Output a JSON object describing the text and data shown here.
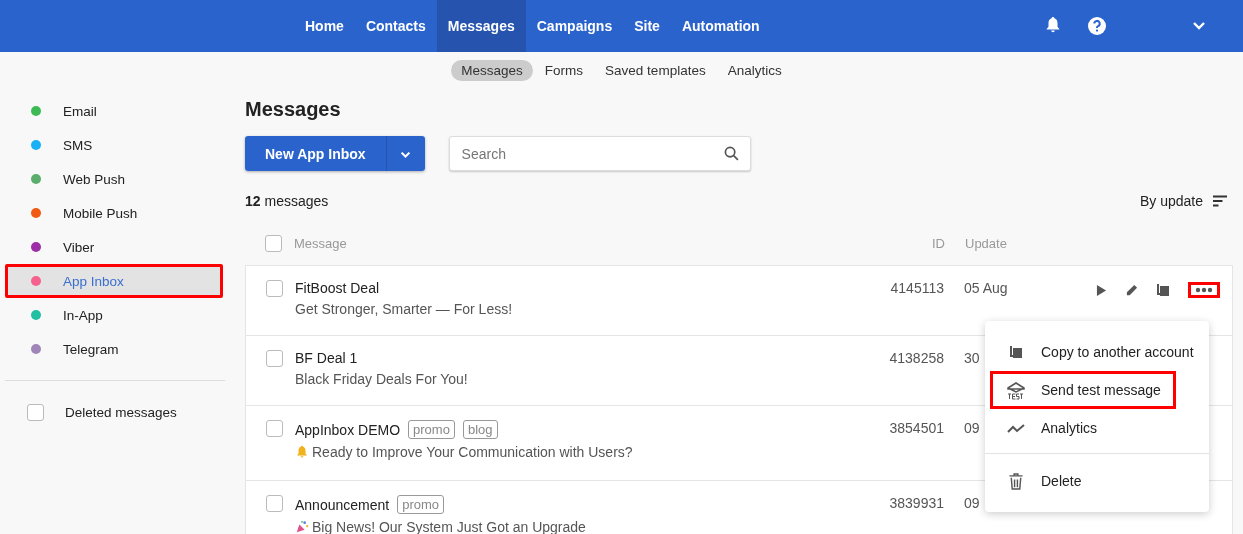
{
  "top_nav": {
    "items": [
      {
        "label": "Home",
        "selected": false
      },
      {
        "label": "Contacts",
        "selected": false
      },
      {
        "label": "Messages",
        "selected": true
      },
      {
        "label": "Campaigns",
        "selected": false
      },
      {
        "label": "Site",
        "selected": false
      },
      {
        "label": "Automation",
        "selected": false
      }
    ]
  },
  "sub_nav": {
    "items": [
      {
        "label": "Messages",
        "selected": true
      },
      {
        "label": "Forms",
        "selected": false
      },
      {
        "label": "Saved templates",
        "selected": false
      },
      {
        "label": "Analytics",
        "selected": false
      }
    ]
  },
  "sidebar": {
    "channels": [
      {
        "label": "Email",
        "color": "#3cba54",
        "selected": false,
        "highlighted": false
      },
      {
        "label": "SMS",
        "color": "#1ab0f5",
        "selected": false,
        "highlighted": false
      },
      {
        "label": "Web Push",
        "color": "#5aad6a",
        "selected": false,
        "highlighted": false
      },
      {
        "label": "Mobile Push",
        "color": "#f05a12",
        "selected": false,
        "highlighted": false
      },
      {
        "label": "Viber",
        "color": "#9c2ea6",
        "selected": false,
        "highlighted": false
      },
      {
        "label": "App Inbox",
        "color": "#f5608f",
        "selected": true,
        "highlighted": true
      },
      {
        "label": "In-App",
        "color": "#22bfa3",
        "selected": false,
        "highlighted": false
      },
      {
        "label": "Telegram",
        "color": "#a086b8",
        "selected": false,
        "highlighted": false
      }
    ],
    "deleted": {
      "label": "Deleted messages",
      "checked": false
    }
  },
  "page_title": "Messages",
  "new_button": {
    "label": "New App Inbox"
  },
  "search": {
    "placeholder": "Search"
  },
  "count": {
    "number": "12",
    "label": "messages"
  },
  "sort": {
    "label": "By update"
  },
  "table": {
    "header_checked": false,
    "columns": [
      "Message",
      "ID",
      "Update"
    ],
    "rows": [
      {
        "title": "FitBoost Deal",
        "tags": [],
        "preview": "Get Stronger, Smarter — For Less!",
        "kind": "plain",
        "id": "4145113",
        "update": "05 Aug",
        "checked": false
      },
      {
        "title": "BF Deal 1",
        "tags": [],
        "preview": "Black Friday Deals For You!",
        "kind": "plain",
        "id": "4138258",
        "update": "30",
        "checked": false
      },
      {
        "title": "AppInbox DEMO",
        "tags": [
          "promo",
          "blog"
        ],
        "preview": "Ready to Improve Your Communication with Users?",
        "kind": "bell",
        "id": "3854501",
        "update": "09",
        "checked": false
      },
      {
        "title": "Announcement",
        "tags": [
          "promo"
        ],
        "preview": "Big News! Our System Just Got an Upgrade",
        "kind": "confetti",
        "id": "3839931",
        "update": "09",
        "checked": false
      }
    ]
  },
  "row_actions": {
    "more_highlighted": true
  },
  "menu": {
    "items": [
      {
        "label": "Copy to another account",
        "kind": "copy",
        "highlighted": false,
        "divider_before": false
      },
      {
        "label": "Send test message",
        "kind": "test",
        "highlighted": true,
        "divider_before": false
      },
      {
        "label": "Analytics",
        "kind": "analytics",
        "highlighted": false,
        "divider_before": false
      },
      {
        "label": "Delete",
        "kind": "delete",
        "highlighted": false,
        "divider_before": true
      }
    ]
  }
}
